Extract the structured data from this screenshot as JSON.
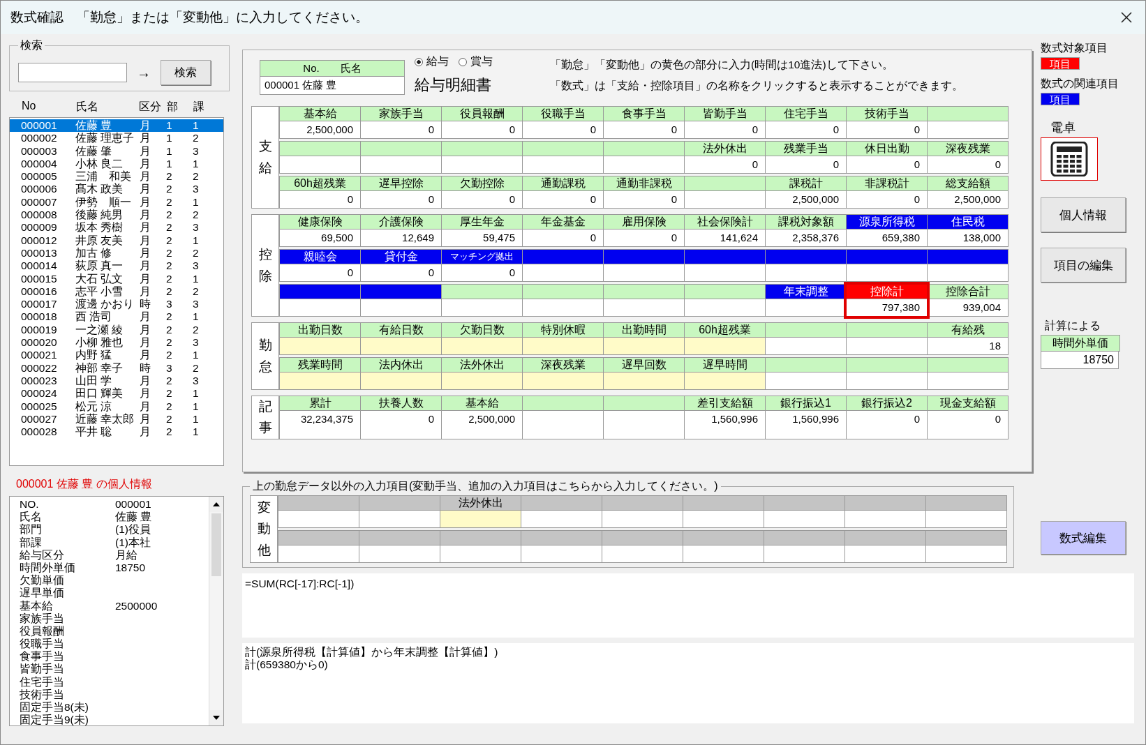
{
  "window": {
    "title": "数式確認　「勤怠」または「変動他」に入力してください。"
  },
  "search": {
    "legend": "検索",
    "arrow": "→",
    "button": "検索"
  },
  "employee_list": {
    "columns": [
      "No",
      "氏名",
      "区分",
      "部",
      "課"
    ],
    "rows": [
      {
        "no": "000001",
        "name": "佐藤 豊",
        "kubun": "月",
        "bu": "1",
        "ka": "1",
        "selected": true
      },
      {
        "no": "000002",
        "name": "佐藤 理恵子",
        "kubun": "月",
        "bu": "1",
        "ka": "2",
        "selected": false
      },
      {
        "no": "000003",
        "name": "佐藤 肇",
        "kubun": "月",
        "bu": "1",
        "ka": "3",
        "selected": false
      },
      {
        "no": "000004",
        "name": "小林 良二",
        "kubun": "月",
        "bu": "1",
        "ka": "1",
        "selected": false
      },
      {
        "no": "000005",
        "name": "三浦　和美",
        "kubun": "月",
        "bu": "2",
        "ka": "2",
        "selected": false
      },
      {
        "no": "000006",
        "name": "髙木 政美",
        "kubun": "月",
        "bu": "2",
        "ka": "3",
        "selected": false
      },
      {
        "no": "000007",
        "name": "伊勢　順一",
        "kubun": "月",
        "bu": "2",
        "ka": "1",
        "selected": false
      },
      {
        "no": "000008",
        "name": "後藤 純男",
        "kubun": "月",
        "bu": "2",
        "ka": "2",
        "selected": false
      },
      {
        "no": "000009",
        "name": "坂本 秀樹",
        "kubun": "月",
        "bu": "2",
        "ka": "3",
        "selected": false
      },
      {
        "no": "000012",
        "name": "井原 友美",
        "kubun": "月",
        "bu": "2",
        "ka": "1",
        "selected": false
      },
      {
        "no": "000013",
        "name": "加古 修",
        "kubun": "月",
        "bu": "2",
        "ka": "2",
        "selected": false
      },
      {
        "no": "000014",
        "name": "荻原 真一",
        "kubun": "月",
        "bu": "2",
        "ka": "3",
        "selected": false
      },
      {
        "no": "000015",
        "name": "大石 弘文",
        "kubun": "月",
        "bu": "2",
        "ka": "1",
        "selected": false
      },
      {
        "no": "000016",
        "name": "志平 小雪",
        "kubun": "月",
        "bu": "2",
        "ka": "2",
        "selected": false
      },
      {
        "no": "000017",
        "name": "渡邊 かおり",
        "kubun": "時",
        "bu": "3",
        "ka": "3",
        "selected": false
      },
      {
        "no": "000018",
        "name": "西 浩司",
        "kubun": "月",
        "bu": "2",
        "ka": "1",
        "selected": false
      },
      {
        "no": "000019",
        "name": "一之瀬 綾",
        "kubun": "月",
        "bu": "2",
        "ka": "2",
        "selected": false
      },
      {
        "no": "000020",
        "name": "小柳 雅也",
        "kubun": "月",
        "bu": "2",
        "ka": "3",
        "selected": false
      },
      {
        "no": "000021",
        "name": "内野 猛",
        "kubun": "月",
        "bu": "2",
        "ka": "1",
        "selected": false
      },
      {
        "no": "000022",
        "name": "神部 幸子",
        "kubun": "時",
        "bu": "3",
        "ka": "2",
        "selected": false
      },
      {
        "no": "000023",
        "name": "山田 学",
        "kubun": "月",
        "bu": "2",
        "ka": "3",
        "selected": false
      },
      {
        "no": "000024",
        "name": "田口 輝美",
        "kubun": "月",
        "bu": "2",
        "ka": "1",
        "selected": false
      },
      {
        "no": "000025",
        "name": "松元 涼",
        "kubun": "月",
        "bu": "2",
        "ka": "1",
        "selected": false
      },
      {
        "no": "000027",
        "name": "近藤 幸太郎",
        "kubun": "月",
        "bu": "2",
        "ka": "1",
        "selected": false
      },
      {
        "no": "000028",
        "name": "平井 聡",
        "kubun": "月",
        "bu": "2",
        "ka": "1",
        "selected": false
      }
    ]
  },
  "personal_info": {
    "title": "000001 佐藤 豊 の個人情報",
    "rows": [
      {
        "label": "NO.",
        "value": "000001"
      },
      {
        "label": "氏名",
        "value": "佐藤 豊"
      },
      {
        "label": "部門",
        "value": "(1)役員"
      },
      {
        "label": "部課",
        "value": "(1)本社"
      },
      {
        "label": "給与区分",
        "value": "月給"
      },
      {
        "label": "時間外単価",
        "value": "18750"
      },
      {
        "label": "欠勤単価"
      },
      {
        "label": "遅早単価"
      },
      {
        "label": "基本給",
        "value": "2500000"
      },
      {
        "label": "家族手当"
      },
      {
        "label": "役員報酬"
      },
      {
        "label": "役職手当"
      },
      {
        "label": "食事手当"
      },
      {
        "label": "皆勤手当"
      },
      {
        "label": "住宅手当"
      },
      {
        "label": "技術手当"
      },
      {
        "label": "固定手当8(未)"
      },
      {
        "label": "固定手当9(未)"
      }
    ]
  },
  "slip": {
    "id_header": "No.　　氏名",
    "id_value": "000001 佐藤 豊",
    "radios": [
      {
        "label": "給与",
        "selected": true
      },
      {
        "label": "賞与",
        "selected": false
      }
    ],
    "heading": "給与明細書",
    "notes": [
      "「勤怠」「変動他」の黄色の部分に入力(時間は10進法)して下さい。",
      "「数式」は「支給・控除項目」の名称をクリックすると表示することができます。"
    ],
    "sections": [
      {
        "label": "支給",
        "rows": [
          [
            {
              "label": "基本給",
              "value": "2,500,000",
              "kind": "normal",
              "entry": false
            },
            {
              "label": "家族手当",
              "value": "0",
              "kind": "normal",
              "entry": false
            },
            {
              "label": "役員報酬",
              "value": "0",
              "kind": "normal",
              "entry": false
            },
            {
              "label": "役職手当",
              "value": "0",
              "kind": "normal",
              "entry": false
            },
            {
              "label": "食事手当",
              "value": "0",
              "kind": "normal",
              "entry": false
            },
            {
              "label": "皆勤手当",
              "value": "0",
              "kind": "normal",
              "entry": false
            },
            {
              "label": "住宅手当",
              "value": "0",
              "kind": "normal",
              "entry": false
            },
            {
              "label": "技術手当",
              "value": "0",
              "kind": "normal",
              "entry": false
            },
            {
              "kind": "normal",
              "entry": false
            }
          ],
          [
            {
              "kind": "normal",
              "entry": false
            },
            {
              "kind": "normal",
              "entry": false
            },
            {
              "kind": "normal",
              "entry": false
            },
            {
              "kind": "normal",
              "entry": false
            },
            {
              "kind": "normal",
              "entry": false
            },
            {
              "label": "法外休出",
              "value": "0",
              "kind": "normal",
              "entry": false
            },
            {
              "label": "残業手当",
              "value": "0",
              "kind": "normal",
              "entry": false
            },
            {
              "label": "休日出勤",
              "value": "0",
              "kind": "normal",
              "entry": false
            },
            {
              "label": "深夜残業",
              "value": "0",
              "kind": "normal",
              "entry": false
            }
          ],
          [
            {
              "label": "60h超残業",
              "value": "0",
              "kind": "normal",
              "entry": false
            },
            {
              "label": "遅早控除",
              "value": "0",
              "kind": "normal",
              "entry": false
            },
            {
              "label": "欠勤控除",
              "value": "0",
              "kind": "normal",
              "entry": false
            },
            {
              "label": "通勤課税",
              "value": "0",
              "kind": "normal",
              "entry": false
            },
            {
              "label": "通勤非課税",
              "value": "0",
              "kind": "normal",
              "entry": false
            },
            {
              "kind": "normal",
              "entry": false
            },
            {
              "label": "課税計",
              "value": "2,500,000",
              "kind": "normal",
              "entry": false
            },
            {
              "label": "非課税計",
              "value": "0",
              "kind": "normal",
              "entry": false
            },
            {
              "label": "総支給額",
              "value": "2,500,000",
              "kind": "normal",
              "entry": false
            }
          ]
        ]
      },
      {
        "label": "控除",
        "rows": [
          [
            {
              "label": "健康保険",
              "value": "69,500",
              "kind": "normal",
              "entry": false
            },
            {
              "label": "介護保険",
              "value": "12,649",
              "kind": "normal",
              "entry": false
            },
            {
              "label": "厚生年金",
              "value": "59,475",
              "kind": "normal",
              "entry": false
            },
            {
              "label": "年金基金",
              "value": "0",
              "kind": "normal",
              "entry": false
            },
            {
              "label": "雇用保険",
              "value": "0",
              "kind": "normal",
              "entry": false
            },
            {
              "label": "社会保険計",
              "value": "141,624",
              "kind": "normal",
              "entry": false
            },
            {
              "label": "課税対象額",
              "value": "2,358,376",
              "kind": "normal",
              "entry": false
            },
            {
              "label": "源泉所得税",
              "value": "659,380",
              "kind": "related",
              "entry": false
            },
            {
              "label": "住民税",
              "value": "138,000",
              "kind": "related",
              "entry": false
            }
          ],
          [
            {
              "label": "親睦会",
              "value": "0",
              "kind": "related",
              "entry": false
            },
            {
              "label": "貸付金",
              "value": "0",
              "kind": "related",
              "entry": false
            },
            {
              "label": "マッチング拠出",
              "value": "0",
              "kind": "related",
              "entry": false
            },
            {
              "kind": "related",
              "entry": false
            },
            {
              "kind": "related",
              "entry": false
            },
            {
              "kind": "related",
              "entry": false
            },
            {
              "kind": "related",
              "entry": false
            },
            {
              "kind": "related",
              "entry": false
            },
            {
              "kind": "related",
              "entry": false
            }
          ],
          [
            {
              "kind": "related",
              "entry": false
            },
            {
              "kind": "related",
              "entry": false
            },
            {
              "kind": "normal",
              "entry": false
            },
            {
              "kind": "normal",
              "entry": false
            },
            {
              "kind": "normal",
              "entry": false
            },
            {
              "kind": "normal",
              "entry": false
            },
            {
              "label": "年末調整",
              "kind": "related",
              "entry": false
            },
            {
              "label": "控除計",
              "value": "797,380",
              "kind": "target",
              "entry": false
            },
            {
              "label": "控除合計",
              "value": "939,004",
              "kind": "normal",
              "entry": false
            }
          ]
        ]
      },
      {
        "label": "勤怠",
        "rows": [
          [
            {
              "label": "出勤日数",
              "kind": "normal",
              "entry": true
            },
            {
              "label": "有給日数",
              "kind": "normal",
              "entry": true
            },
            {
              "label": "欠勤日数",
              "kind": "normal",
              "entry": true
            },
            {
              "label": "特別休暇",
              "kind": "normal",
              "entry": true
            },
            {
              "label": "出勤時間",
              "kind": "normal",
              "entry": true
            },
            {
              "label": "60h超残業",
              "kind": "normal",
              "entry": true
            },
            {
              "kind": "normal",
              "entry": false
            },
            {
              "kind": "normal",
              "entry": false
            },
            {
              "label": "有給残",
              "value": "18",
              "kind": "normal",
              "entry": false
            }
          ],
          [
            {
              "label": "残業時間",
              "kind": "normal",
              "entry": true
            },
            {
              "label": "法内休出",
              "kind": "normal",
              "entry": true
            },
            {
              "label": "法外休出",
              "kind": "normal",
              "entry": true
            },
            {
              "label": "深夜残業",
              "kind": "normal",
              "entry": true
            },
            {
              "label": "遅早回数",
              "kind": "normal",
              "entry": true
            },
            {
              "label": "遅早時間",
              "kind": "normal",
              "entry": true
            },
            {
              "kind": "normal",
              "entry": false
            },
            {
              "kind": "normal",
              "entry": false
            },
            {
              "kind": "normal",
              "entry": false
            }
          ]
        ]
      },
      {
        "label": "記事",
        "rows": [
          [
            {
              "label": "累計",
              "value": "32,234,375",
              "kind": "normal",
              "entry": false
            },
            {
              "label": "扶養人数",
              "value": "0",
              "kind": "normal",
              "entry": false
            },
            {
              "label": "基本給",
              "value": "2,500,000",
              "kind": "normal",
              "entry": false
            },
            {
              "kind": "normal",
              "entry": false
            },
            {
              "kind": "normal",
              "entry": false
            },
            {
              "label": "差引支給額",
              "value": "1,560,996",
              "kind": "normal",
              "entry": false
            },
            {
              "label": "銀行振込1",
              "value": "1,560,996",
              "kind": "normal",
              "entry": false
            },
            {
              "label": "銀行振込2",
              "value": "0",
              "kind": "normal",
              "entry": false
            },
            {
              "label": "現金支給額",
              "value": "0",
              "kind": "normal",
              "entry": false
            }
          ]
        ]
      }
    ]
  },
  "extra_inputs": {
    "legend": "上の勤怠データ以外の入力項目(変動手当、追加の入力項目はこちらから入力してください。)",
    "label": "変動他",
    "rows": [
      [
        {
          "kind": "inactive",
          "entry": false
        },
        {
          "kind": "inactive",
          "entry": false
        },
        {
          "label": "法外休出",
          "kind": "inactive",
          "entry": true
        },
        {
          "kind": "inactive",
          "entry": false
        },
        {
          "kind": "inactive",
          "entry": false
        },
        {
          "kind": "inactive",
          "entry": false
        },
        {
          "kind": "inactive",
          "entry": false
        },
        {
          "kind": "inactive",
          "entry": false
        },
        {
          "kind": "inactive",
          "entry": false
        }
      ],
      [
        {
          "kind": "inactive",
          "entry": false
        },
        {
          "kind": "inactive",
          "entry": false
        },
        {
          "kind": "inactive",
          "entry": false
        },
        {
          "kind": "inactive",
          "entry": false
        },
        {
          "kind": "inactive",
          "entry": false
        },
        {
          "kind": "inactive",
          "entry": false
        },
        {
          "kind": "inactive",
          "entry": false
        },
        {
          "kind": "inactive",
          "entry": false
        },
        {
          "kind": "inactive",
          "entry": false
        }
      ]
    ]
  },
  "legend_panel": {
    "target_label": "数式対象項目",
    "target_chip": "項目",
    "related_label": "数式の関連項目",
    "related_chip": "項目",
    "calculator_label": "電卓"
  },
  "buttons": {
    "personal": "個人情報",
    "edit_items": "項目の編集",
    "edit_formula": "数式編集"
  },
  "computed": {
    "caption": "計算による",
    "header": "時間外単価",
    "value": "18750"
  },
  "formula": "=SUM(RC[-17]:RC[-1])",
  "formula_explanation": [
    "計(源泉所得税【計算値】から年末調整【計算値】)",
    "計(659380から0)"
  ]
}
